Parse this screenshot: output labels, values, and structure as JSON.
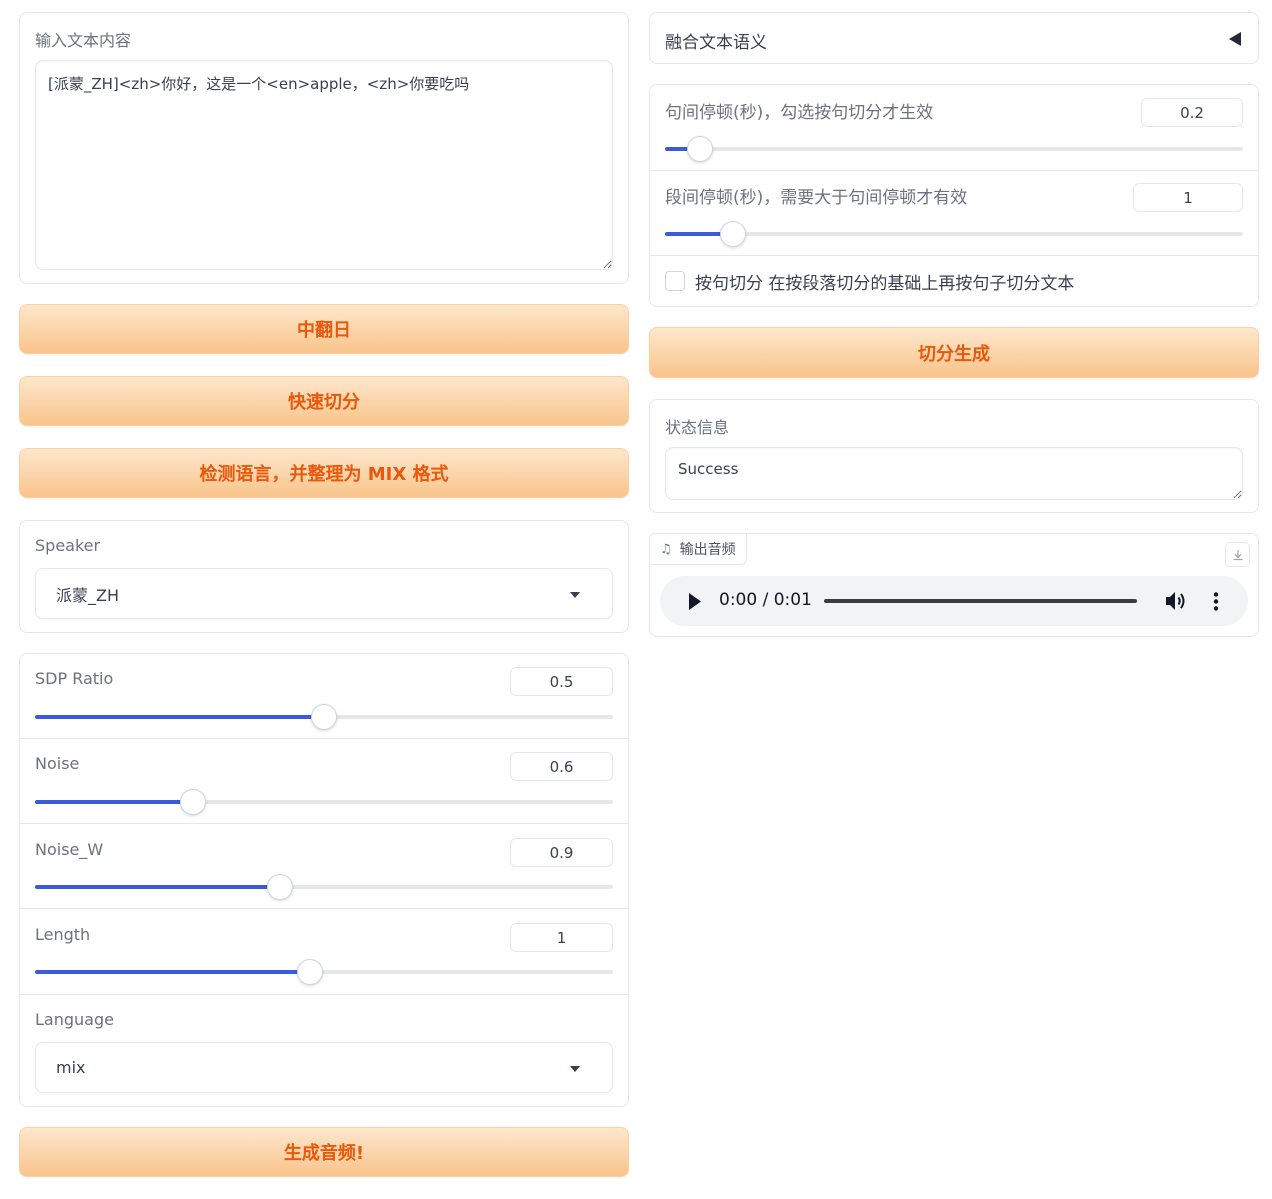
{
  "input_text": {
    "label": "输入文本内容",
    "value": "[派蒙_ZH]<zh>你好，这是一个<en>apple，<zh>你要吃吗"
  },
  "buttons": {
    "translate_label": "中翻日",
    "quick_split_label": "快速切分",
    "detect_lang_label": "检测语言，并整理为 MIX 格式",
    "generate_label": "生成音频!",
    "split_generate_label": "切分生成"
  },
  "speaker": {
    "label": "Speaker",
    "value": "派蒙_ZH"
  },
  "sliders": {
    "sdp_ratio": {
      "label": "SDP Ratio",
      "value": "0.5",
      "fraction": 0.5
    },
    "noise": {
      "label": "Noise",
      "value": "0.6",
      "fraction": 0.273
    },
    "noise_w": {
      "label": "Noise_W",
      "value": "0.9",
      "fraction": 0.424
    },
    "length": {
      "label": "Length",
      "value": "1",
      "fraction": 0.475
    }
  },
  "language": {
    "label": "Language",
    "value": "mix"
  },
  "fusion": {
    "label": "融合文本语义"
  },
  "pause": {
    "sentence": {
      "label": "句间停顿(秒)，勾选按句切分才生效",
      "value": "0.2",
      "fraction": 0.06
    },
    "paragraph": {
      "label": "段间停顿(秒)，需要大于句间停顿才有效",
      "value": "1",
      "fraction": 0.117
    }
  },
  "sentence_split": {
    "label": "按句切分 在按段落切分的基础上再按句子切分文本",
    "checked": false
  },
  "status": {
    "label": "状态信息",
    "value": "Success"
  },
  "audio": {
    "label": "输出音频",
    "time": "0:00 / 0:01"
  },
  "colors": {
    "accent": "#3b5bdb",
    "button_text": "#ea580c",
    "button_bg": "#f9c48a"
  }
}
